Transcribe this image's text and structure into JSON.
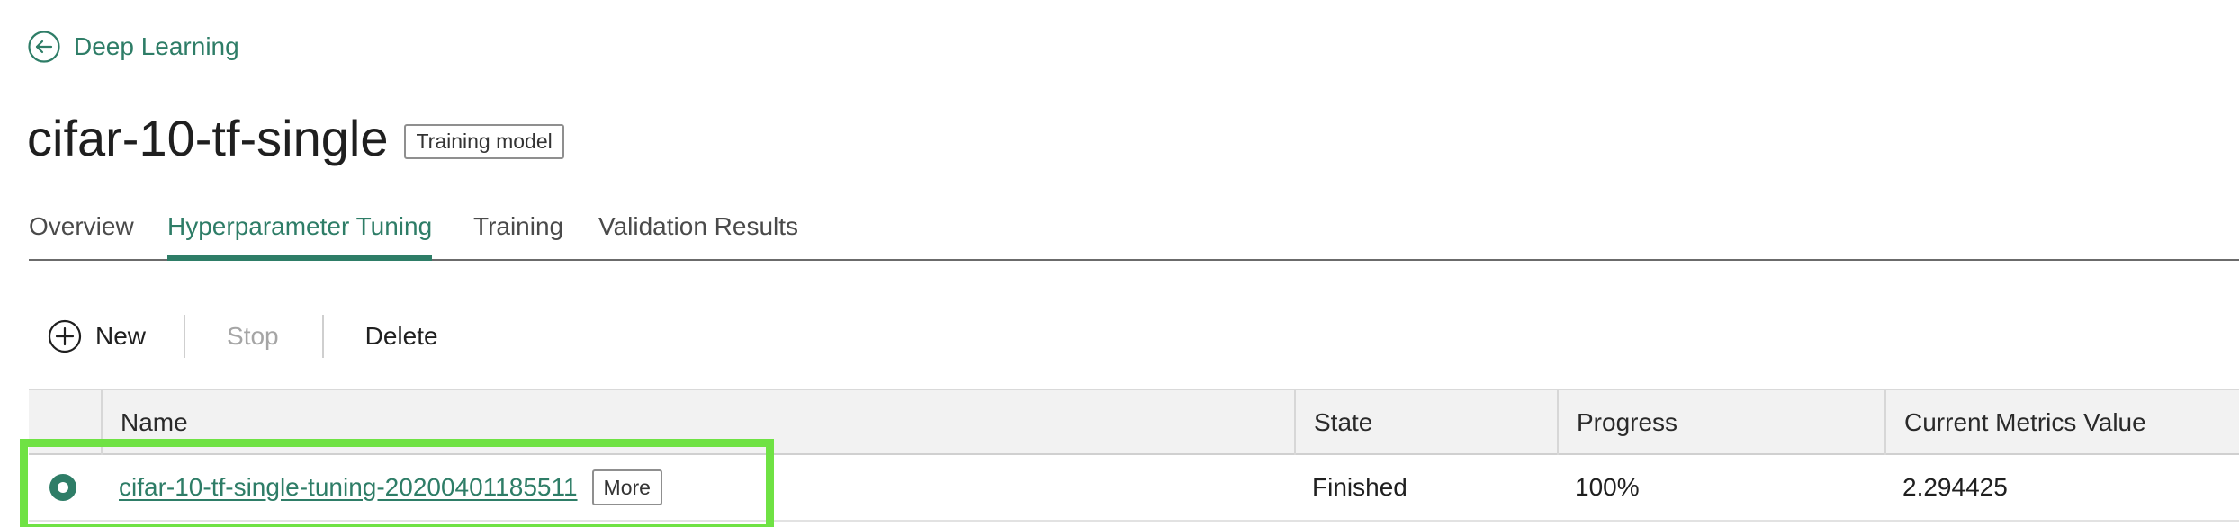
{
  "breadcrumb": {
    "back_label": "Deep Learning",
    "back_icon": "arrow-left-circle-icon"
  },
  "header": {
    "title": "cifar-10-tf-single",
    "type_tag": "Training model"
  },
  "tabs": [
    {
      "label": "Overview",
      "active": false
    },
    {
      "label": "Hyperparameter Tuning",
      "active": true
    },
    {
      "label": "Training",
      "active": false
    },
    {
      "label": "Validation Results",
      "active": false
    }
  ],
  "toolbar": {
    "new_label": "New",
    "new_icon": "plus-circle-icon",
    "stop_label": "Stop",
    "stop_disabled": true,
    "delete_label": "Delete"
  },
  "table": {
    "columns": [
      "Name",
      "State",
      "Progress",
      "Current Metrics Value"
    ],
    "rows": [
      {
        "selected": true,
        "name": "cifar-10-tf-single-tuning-20200401185511",
        "more_label": "More",
        "state": "Finished",
        "progress": "100%",
        "metrics": "2.294425"
      }
    ]
  },
  "colors": {
    "accent": "#2e7d67",
    "highlight": "#6fe244",
    "disabled_text": "#a5a5a5"
  }
}
